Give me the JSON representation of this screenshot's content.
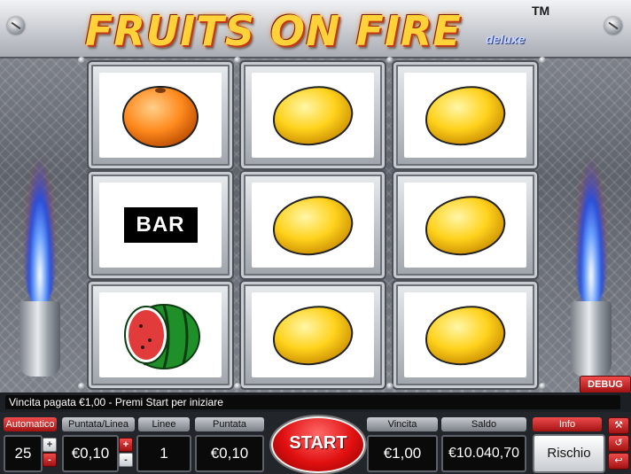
{
  "game": {
    "logo_title": "FRUITS ON FIRE",
    "logo_subtitle": "deluxe",
    "logo_tm": "TM"
  },
  "reels": [
    [
      "orange",
      "lemon",
      "lemon"
    ],
    [
      "bar",
      "lemon",
      "lemon"
    ],
    [
      "watermelon",
      "lemon",
      "lemon"
    ]
  ],
  "symbols": {
    "bar_text": "BAR"
  },
  "status": {
    "message": "Vincita pagata €1,00 - Premi Start per iniziare",
    "debug_label": "DEBUG"
  },
  "controls": {
    "automatico_label": "Automatico",
    "automatico_value": "25",
    "puntata_linea_label": "Puntata/Linea",
    "puntata_linea_value": "€0,10",
    "linee_label": "Linee",
    "linee_value": "1",
    "puntata_label": "Puntata",
    "puntata_value": "€0,10",
    "start_label": "START",
    "vincita_label": "Vincita",
    "vincita_value": "€1,00",
    "saldo_label": "Saldo",
    "saldo_value": "€10.040,70",
    "info_label": "Info",
    "rischio_label": "Rischio",
    "plus": "+",
    "minus": "-"
  },
  "icons": {
    "settings": "wrench-icon",
    "history": "history-icon",
    "exit": "exit-icon"
  },
  "colors": {
    "accent_red": "#c81818",
    "lemon": "#ffd21c",
    "orange": "#ff8a1e"
  }
}
